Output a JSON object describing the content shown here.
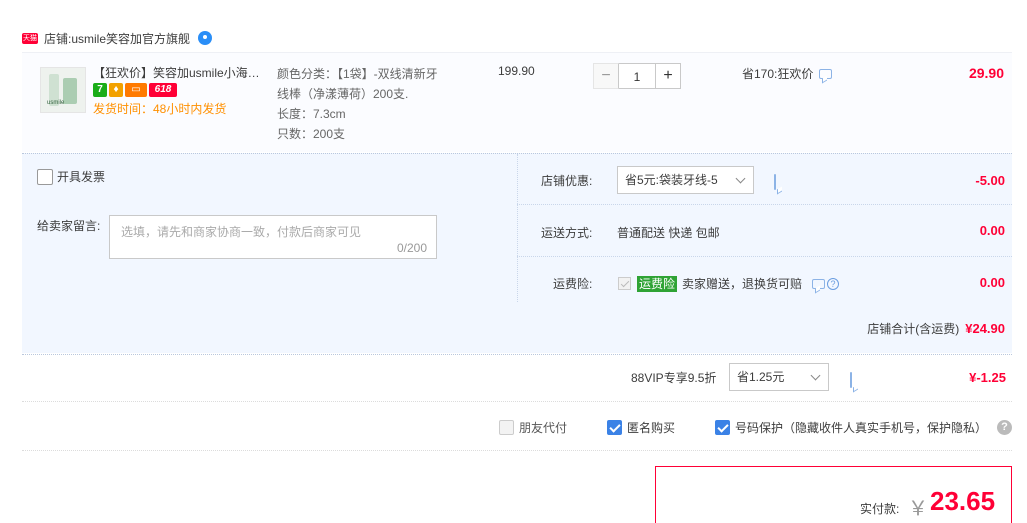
{
  "shop": {
    "tmall_badge": "天猫",
    "label": "店铺: ",
    "name": "usmile笑容加官方旗舰"
  },
  "item": {
    "thumb_brand": "usmile",
    "title": "【狂欢价】笑容加usmile小海…",
    "badges": {
      "seven": "7",
      "promo": "618"
    },
    "ship_time": "发货时间：48小时内发货",
    "sku_lines": [
      "颜色分类：【1袋】-双线清新牙",
      "线棒（净漾薄荷）200支.",
      "长度：7.3cm",
      "只数：200支"
    ],
    "unit_price": "199.90",
    "quantity": "1",
    "qty_minus": "−",
    "qty_plus": "+",
    "saving_note": "省170:狂欢价",
    "line_total": "29.90"
  },
  "options": {
    "invoice_label": "开具发票",
    "memo_label": "给卖家留言:",
    "memo_placeholder": "选填，请先和商家协商一致，付款后商家可见",
    "memo_count": "0/200",
    "shop_discount_label": "店铺优惠:",
    "shop_discount_value": "省5元:袋装牙线-5",
    "shop_discount_amount": "-5.00",
    "delivery_label": "运送方式:",
    "delivery_value": "普通配送 快递 包邮",
    "delivery_amount": "0.00",
    "insurance_label": "运费险:",
    "insurance_badge": "运费险",
    "insurance_desc": "卖家赠送，退换货可赔",
    "insurance_amount": "0.00",
    "subtotal_label": "店铺合计(含运费)",
    "subtotal_amount": "¥24.90"
  },
  "vip": {
    "label": "88VIP专享9.5折",
    "select_value": "省1.25元",
    "amount": "¥-1.25"
  },
  "checks": {
    "friend_pay": "朋友代付",
    "anonymous": "匿名购买",
    "number_protect": "号码保护（隐藏收件人真实手机号，保护隐私）",
    "help": "?"
  },
  "payment": {
    "label": "实付款:",
    "currency": "￥",
    "amount": "23.65"
  },
  "colors": {
    "accent": "#ff0036",
    "check_blue": "#3b82e6",
    "panel_bg": "#f2f7ff"
  }
}
